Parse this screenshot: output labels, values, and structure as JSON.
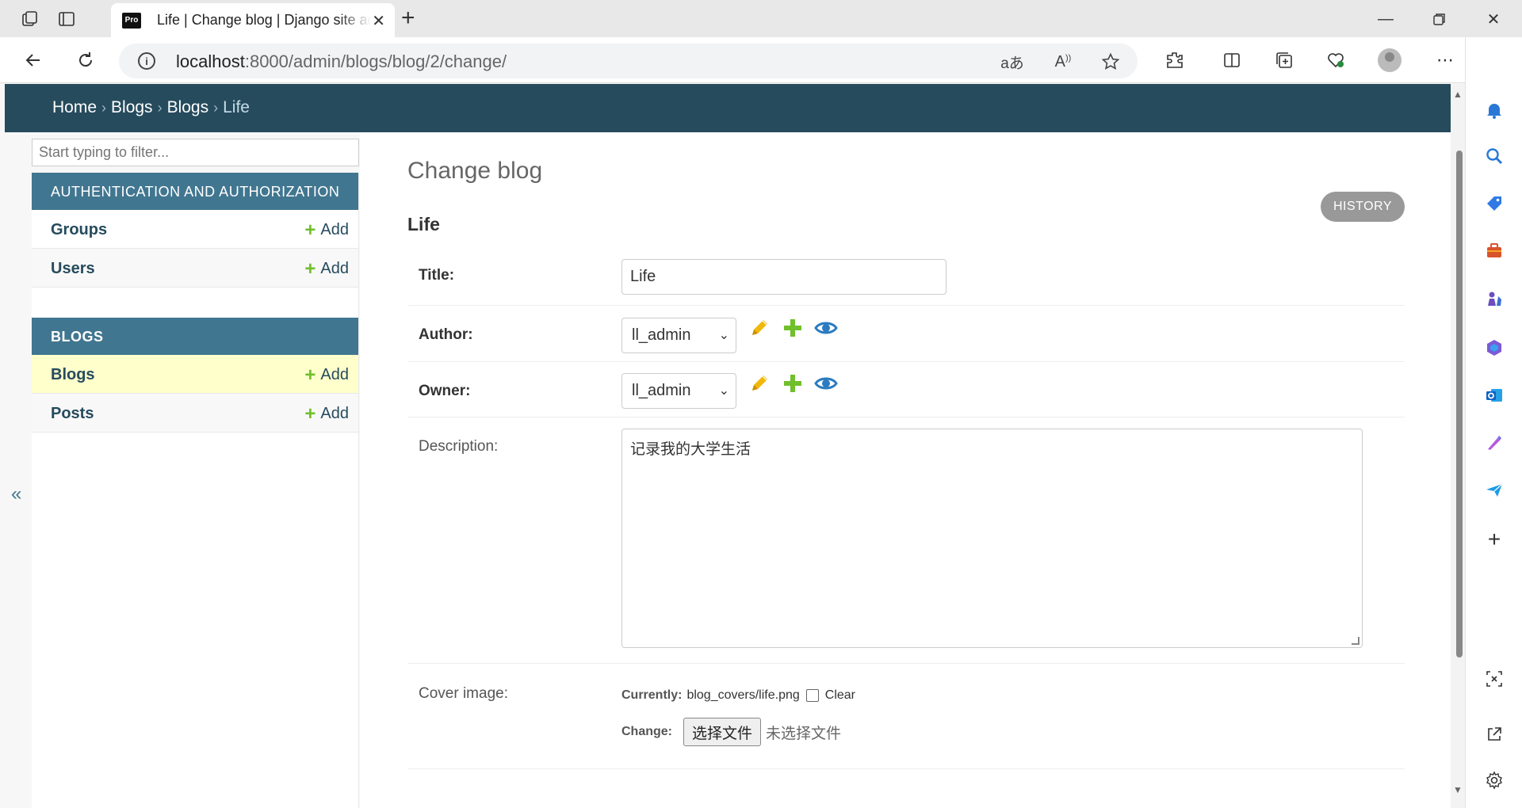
{
  "browser": {
    "tab_title": "Life | Change blog | Django site admin",
    "tab_favicon_text": "Pro",
    "url_host": "localhost",
    "url_path": ":8000/admin/blogs/blog/2/change/"
  },
  "header": {
    "breadcrumbs": [
      "Home",
      "Blogs",
      "Blogs",
      "Life"
    ],
    "separator": "›"
  },
  "nav": {
    "filter_placeholder": "Start typing to filter...",
    "apps": [
      {
        "caption": "AUTHENTICATION AND AUTHORIZATION",
        "models": [
          {
            "name": "Groups",
            "add": "Add"
          },
          {
            "name": "Users",
            "add": "Add"
          }
        ]
      },
      {
        "caption": "BLOGS",
        "models": [
          {
            "name": "Blogs",
            "add": "Add"
          },
          {
            "name": "Posts",
            "add": "Add"
          }
        ]
      }
    ],
    "collapse_glyph": "«"
  },
  "content": {
    "page_title": "Change blog",
    "object_title": "Life",
    "history_label": "HISTORY",
    "fields": {
      "title": {
        "label": "Title:",
        "value": "Life"
      },
      "author": {
        "label": "Author:",
        "value": "ll_admin"
      },
      "owner": {
        "label": "Owner:",
        "value": "ll_admin"
      },
      "description": {
        "label": "Description:",
        "value": "记录我的大学生活"
      },
      "cover_image": {
        "label": "Cover image:",
        "currently_label": "Currently:",
        "currently_value": "blog_covers/life.png",
        "clear_label": "Clear",
        "change_label": "Change:",
        "choose_button": "选择文件",
        "no_file": "未选择文件"
      }
    }
  },
  "colors": {
    "header_bg": "#264b5d",
    "caption_bg": "#417690",
    "add_green": "#70bf2b",
    "current_row": "#ffffcc",
    "edit_yellow": "#efb80b",
    "view_blue": "#2b7bc0"
  }
}
